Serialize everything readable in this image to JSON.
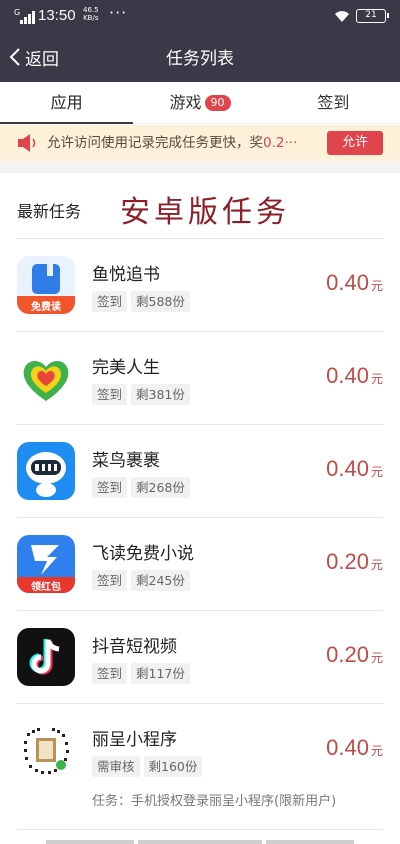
{
  "status_bar": {
    "network": "G",
    "time": "13:50",
    "speed_value": "46.5",
    "speed_unit": "KB/s",
    "more": "···",
    "battery": "21"
  },
  "nav": {
    "back_label": "返回",
    "title": "任务列表"
  },
  "tabs": [
    {
      "label": "应用",
      "active": true
    },
    {
      "label": "游戏",
      "badge": "90"
    },
    {
      "label": "签到"
    }
  ],
  "notice": {
    "text": "允许访问使用记录完成任务更快，奖",
    "amount": "0.2",
    "ellipsis": "···",
    "button": "允许"
  },
  "section": {
    "title": "最新任务",
    "watermark": "安卓版任务"
  },
  "tasks": [
    {
      "name": "鱼悦追书",
      "tags": [
        "签到",
        "剩588份"
      ],
      "price": "0.40",
      "unit": "元",
      "icon_name": "yuyue-book-app-icon",
      "icon_caption": "免费读"
    },
    {
      "name": "完美人生",
      "tags": [
        "签到",
        "剩381份"
      ],
      "price": "0.40",
      "unit": "元",
      "icon_name": "heart-app-icon"
    },
    {
      "name": "菜鸟裹裹",
      "tags": [
        "签到",
        "剩268份"
      ],
      "price": "0.40",
      "unit": "元",
      "icon_name": "cainiao-robot-app-icon"
    },
    {
      "name": "飞读免费小说",
      "tags": [
        "签到",
        "剩245份"
      ],
      "price": "0.20",
      "unit": "元",
      "icon_name": "feidu-novel-app-icon",
      "icon_caption": "领红包"
    },
    {
      "name": "抖音短视频",
      "tags": [
        "签到",
        "剩117份"
      ],
      "price": "0.20",
      "unit": "元",
      "icon_name": "douyin-app-icon"
    },
    {
      "name": "丽呈小程序",
      "tags": [
        "需审核",
        "剩160份"
      ],
      "price": "0.40",
      "unit": "元",
      "icon_name": "mini-program-qr-icon",
      "desc": "任务：手机授权登录丽呈小程序(限新用户)"
    }
  ],
  "colors": {
    "header_bg": "#3b3847",
    "accent_red": "#e0454d",
    "price_red": "#c14b47",
    "notice_bg": "#fdf2d9",
    "watermark": "#8c1f27"
  }
}
